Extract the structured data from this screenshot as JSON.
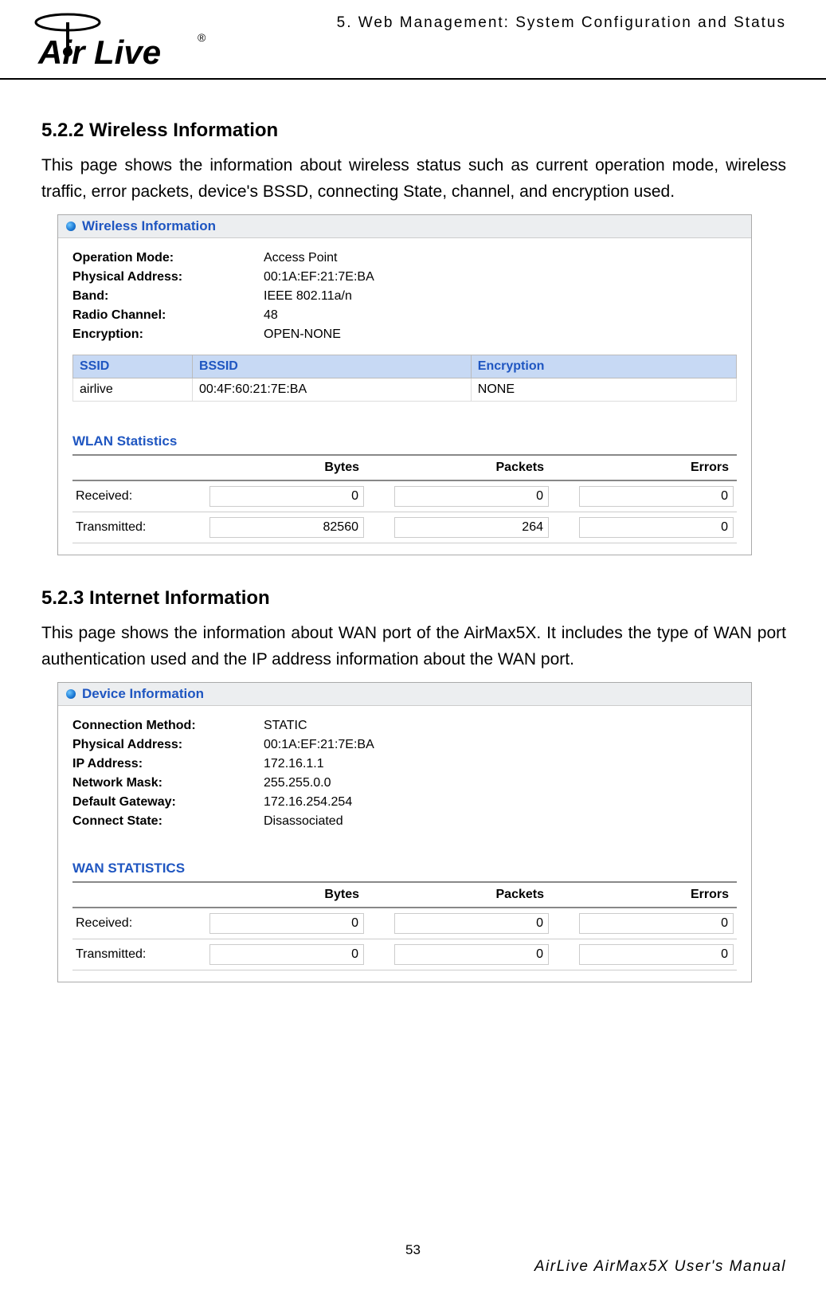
{
  "header_chapter": "5. Web Management: System Configuration and Status",
  "logo_text": "Air Live",
  "section1": {
    "title": "5.2.2 Wireless Information",
    "body": "This page shows the information about wireless status such as current operation mode, wireless traffic, error packets, device's BSSD, connecting State, channel, and encryption used."
  },
  "panel1": {
    "header": "Wireless Information",
    "fields": [
      {
        "label": "Operation Mode:",
        "value": "Access Point"
      },
      {
        "label": "Physical Address:",
        "value": "00:1A:EF:21:7E:BA"
      },
      {
        "label": "Band:",
        "value": "IEEE 802.11a/n"
      },
      {
        "label": "Radio Channel:",
        "value": "48"
      },
      {
        "label": "Encryption:",
        "value": "OPEN-NONE"
      }
    ],
    "grid": {
      "headers": [
        "SSID",
        "BSSID",
        "Encryption"
      ],
      "row": [
        "airlive",
        "00:4F:60:21:7E:BA",
        "NONE"
      ]
    },
    "subhead": "WLAN Statistics",
    "stats": {
      "headers": [
        "",
        "Bytes",
        "Packets",
        "Errors"
      ],
      "rows": [
        {
          "label": "Received:",
          "bytes": "0",
          "packets": "0",
          "errors": "0"
        },
        {
          "label": "Transmitted:",
          "bytes": "82560",
          "packets": "264",
          "errors": "0"
        }
      ]
    }
  },
  "section2": {
    "title": "5.2.3 Internet Information",
    "body": "This page shows the information about WAN port of the AirMax5X. It includes the type of WAN port authentication used and the IP address information about the WAN port."
  },
  "panel2": {
    "header": "Device Information",
    "fields": [
      {
        "label": "Connection Method:",
        "value": "STATIC"
      },
      {
        "label": "Physical Address:",
        "value": "00:1A:EF:21:7E:BA"
      },
      {
        "label": "IP Address:",
        "value": "172.16.1.1"
      },
      {
        "label": "Network Mask:",
        "value": "255.255.0.0"
      },
      {
        "label": "Default Gateway:",
        "value": "172.16.254.254"
      },
      {
        "label": "Connect State:",
        "value": "Disassociated"
      }
    ],
    "subhead": "WAN STATISTICS",
    "stats": {
      "headers": [
        "",
        "Bytes",
        "Packets",
        "Errors"
      ],
      "rows": [
        {
          "label": "Received:",
          "bytes": "0",
          "packets": "0",
          "errors": "0"
        },
        {
          "label": "Transmitted:",
          "bytes": "0",
          "packets": "0",
          "errors": "0"
        }
      ]
    }
  },
  "page_number": "53",
  "footer_manual": "AirLive AirMax5X User's Manual"
}
